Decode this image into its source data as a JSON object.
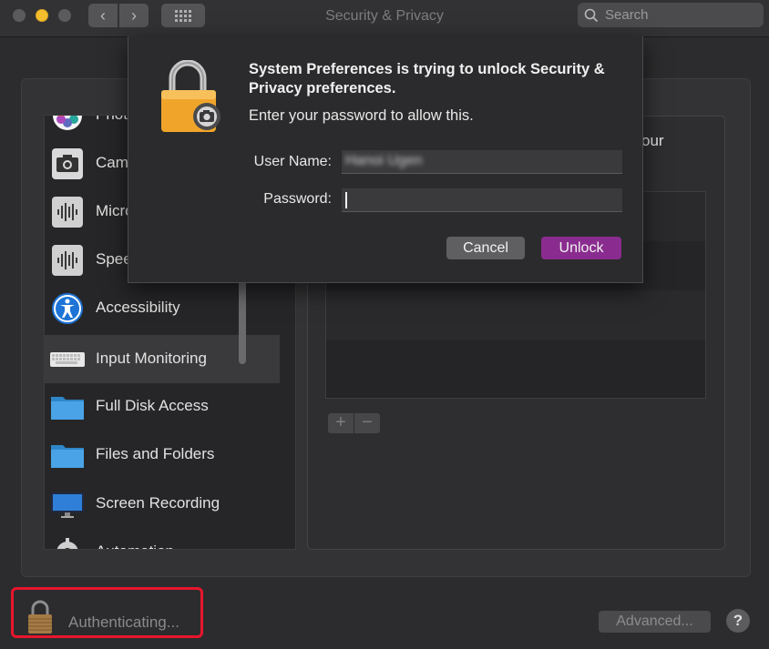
{
  "window": {
    "title": "Security & Privacy"
  },
  "search": {
    "placeholder": "Search"
  },
  "sidebar": {
    "items": [
      {
        "label": "Photos",
        "icon": "photos-icon"
      },
      {
        "label": "Camera",
        "icon": "camera-icon"
      },
      {
        "label": "Microphone",
        "icon": "microphone-icon"
      },
      {
        "label": "Speech Recognition",
        "icon": "speech-icon"
      },
      {
        "label": "Accessibility",
        "icon": "accessibility-icon"
      },
      {
        "label": "Input Monitoring",
        "icon": "keyboard-icon",
        "selected": true
      },
      {
        "label": "Full Disk Access",
        "icon": "folder-icon"
      },
      {
        "label": "Files and Folders",
        "icon": "folder-icon"
      },
      {
        "label": "Screen Recording",
        "icon": "display-icon"
      },
      {
        "label": "Automation",
        "icon": "gear-icon"
      }
    ]
  },
  "right_panel": {
    "partial_text": "our"
  },
  "list_controls": {
    "add": "+",
    "remove": "−"
  },
  "bottom": {
    "status": "Authenticating...",
    "advanced_label": "Advanced...",
    "help_label": "?"
  },
  "dialog": {
    "title": "System Preferences is trying to unlock Security & Privacy preferences.",
    "message": "Enter your password to allow this.",
    "username_label": "User Name:",
    "username_value": "Hanoi Ugen",
    "password_label": "Password:",
    "password_value": "",
    "cancel_label": "Cancel",
    "unlock_label": "Unlock"
  },
  "colors": {
    "unlock_button": "#8a2c8f",
    "highlight_border": "#e8152d",
    "traffic_yellow": "#f3bd2c"
  }
}
